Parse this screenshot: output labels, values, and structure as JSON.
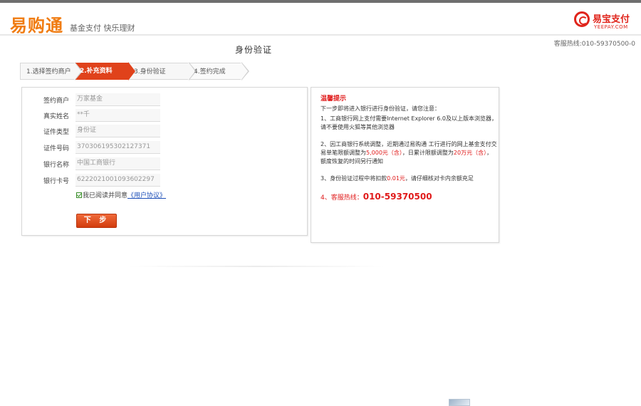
{
  "header": {
    "logo_text": "易购通",
    "slogan": "基金支付  快乐理财",
    "brand_name": "易宝支付",
    "brand_sub": "YEEPAY.COM",
    "hotline": "客服热线:010-59370500-0"
  },
  "page": {
    "title": "身份验证"
  },
  "steps": [
    {
      "label": "1.选择签约商户"
    },
    {
      "label": "2.补充资料"
    },
    {
      "label": "3.身份验证"
    },
    {
      "label": "4.签约完成"
    }
  ],
  "form": {
    "rows": [
      {
        "label": "签约商户",
        "value": "万家基金"
      },
      {
        "label": "真实姓名",
        "value": "**千"
      },
      {
        "label": "证件类型",
        "value": "身份证"
      },
      {
        "label": "证件号码",
        "value": "370306195302127371"
      },
      {
        "label": "银行名称",
        "value": "中国工商银行"
      },
      {
        "label": "银行卡号",
        "value": "6222021001093602297"
      }
    ],
    "agree_text": "我已阅读并同意",
    "agree_link": "《用户协议》",
    "next_label": "下 步"
  },
  "tips": {
    "title": "温馨提示",
    "intro": "下一步即将进入银行进行身份验证，请您注意：",
    "item1_a": "1、工商银行网上支付需要Internet Explorer 6.0及以上版本浏览器，请不要使用火狐等其他浏览器",
    "item2_a": "2、因工商银行系统调整，近期通过易购通 工行进行的网上基金支付交易单笔限额调整为",
    "item2_red1": "5,000元（含）",
    "item2_b": "，日累计限额调整为",
    "item2_red2": "20万元（含）",
    "item2_c": "，额度恢复的时间另行通知",
    "item3_a": "3、身份验证过程中将扣款",
    "item3_red": "0.01元",
    "item3_b": "，请仔细核对卡内余额充足",
    "phone_label": "4、客服热线：",
    "phone_number": "010-59370500"
  },
  "colors": {
    "accent_orange": "#f07c12",
    "active_step": "#e0421b",
    "warning_red": "#e01a1a",
    "link_blue": "#1d4fb8"
  }
}
